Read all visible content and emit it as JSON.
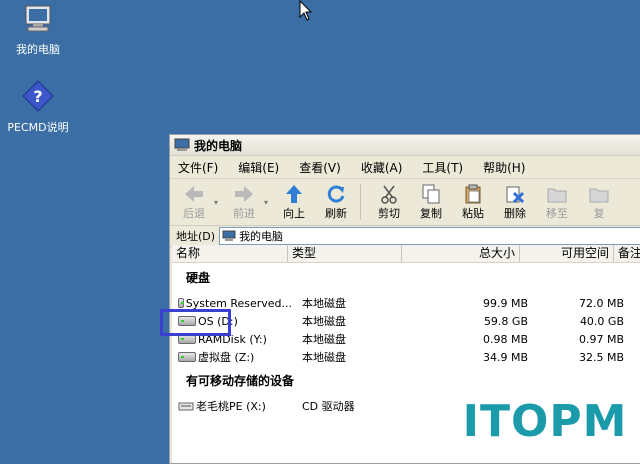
{
  "desktop": {
    "icons": [
      {
        "label": "我的电脑",
        "icon": "computer-icon"
      },
      {
        "label": "PECMD说明",
        "icon": "help-icon"
      }
    ]
  },
  "window": {
    "title": "我的电脑",
    "menu": [
      "文件(F)",
      "编辑(E)",
      "查看(V)",
      "收藏(A)",
      "工具(T)",
      "帮助(H)"
    ],
    "toolbar": {
      "back": "后退",
      "forward": "前进",
      "up": "向上",
      "refresh": "刷新",
      "cut": "剪切",
      "copy": "复制",
      "paste": "粘贴",
      "delete": "删除",
      "move": "移至",
      "copy_to": "复"
    },
    "address": {
      "label": "地址(D)",
      "value": "我的电脑"
    },
    "columns": [
      "名称",
      "类型",
      "总大小",
      "可用空间",
      "备注"
    ],
    "groups": [
      {
        "title": "硬盘",
        "drives": [
          {
            "name": "System Reserved...",
            "type": "本地磁盘",
            "total": "99.9 MB",
            "free": "72.0 MB"
          },
          {
            "name": "OS (D:)",
            "type": "本地磁盘",
            "total": "59.8 GB",
            "free": "40.0 GB"
          },
          {
            "name": "RAMDisk (Y:)",
            "type": "本地磁盘",
            "total": "0.98 MB",
            "free": "0.97 MB"
          },
          {
            "name": "虚拟盘 (Z:)",
            "type": "本地磁盘",
            "total": "34.9 MB",
            "free": "32.5 MB"
          }
        ]
      },
      {
        "title": "有可移动存储的设备",
        "drives": [
          {
            "name": "老毛桃PE (X:)",
            "type": "CD 驱动器",
            "total": "",
            "free": ""
          }
        ]
      }
    ]
  },
  "watermark": "ITOPM"
}
